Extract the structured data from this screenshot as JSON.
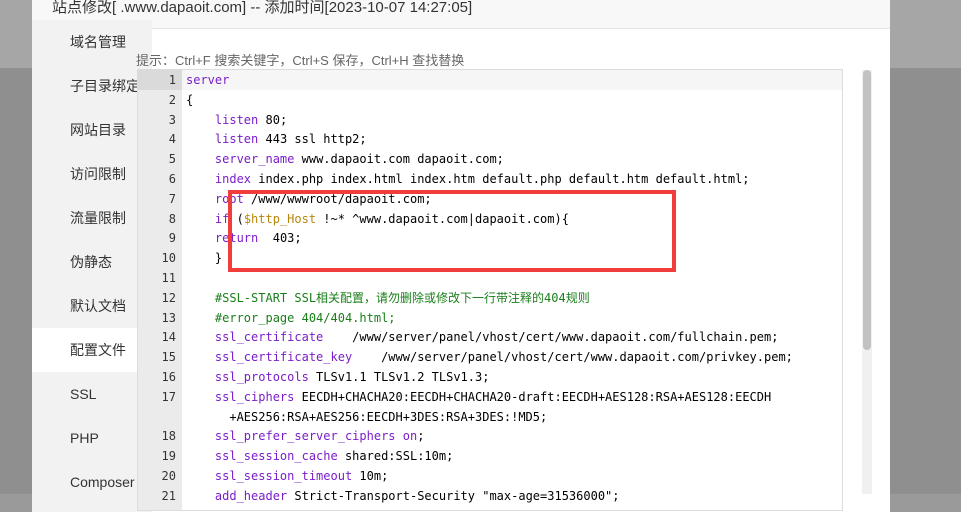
{
  "dialog": {
    "title": "站点修改[ .www.dapaoit.com] -- 添加时间[2023-10-07 14:27:05]"
  },
  "sidebar": {
    "items": [
      {
        "label": "域名管理"
      },
      {
        "label": "子目录绑定"
      },
      {
        "label": "网站目录"
      },
      {
        "label": "访问限制"
      },
      {
        "label": "流量限制"
      },
      {
        "label": "伪静态"
      },
      {
        "label": "默认文档"
      },
      {
        "label": "配置文件",
        "active": true
      },
      {
        "label": "SSL"
      },
      {
        "label": "PHP"
      },
      {
        "label": "Composer"
      }
    ]
  },
  "hint": "提示：Ctrl+F 搜索关键字，Ctrl+S 保存，Ctrl+H 查找替换",
  "editor": {
    "lines": [
      {
        "n": "1",
        "text": "server"
      },
      {
        "n": "2",
        "text": "{"
      },
      {
        "n": "3",
        "text": "    listen 80;"
      },
      {
        "n": "4",
        "text": "    listen 443 ssl http2;"
      },
      {
        "n": "5",
        "text": "    server_name www.dapaoit.com dapaoit.com;"
      },
      {
        "n": "6",
        "text": "    index index.php index.html index.htm default.php default.htm default.html;"
      },
      {
        "n": "7",
        "text": "    root /www/wwwroot/dapaoit.com;"
      },
      {
        "n": "8",
        "text": "    if ($http_Host !~* ^www.dapaoit.com|dapaoit.com){"
      },
      {
        "n": "9",
        "text": "    return  403;"
      },
      {
        "n": "10",
        "text": "    }"
      },
      {
        "n": "11",
        "text": ""
      },
      {
        "n": "12",
        "text": "    #SSL-START SSL相关配置，请勿删除或修改下一行带注释的404规则"
      },
      {
        "n": "13",
        "text": "    #error_page 404/404.html;"
      },
      {
        "n": "14",
        "text": "    ssl_certificate    /www/server/panel/vhost/cert/www.dapaoit.com/fullchain.pem;"
      },
      {
        "n": "15",
        "text": "    ssl_certificate_key    /www/server/panel/vhost/cert/www.dapaoit.com/privkey.pem;"
      },
      {
        "n": "16",
        "text": "    ssl_protocols TLSv1.1 TLSv1.2 TLSv1.3;"
      },
      {
        "n": "17",
        "text": "    ssl_ciphers EECDH+CHACHA20:EECDH+CHACHA20-draft:EECDH+AES128:RSA+AES128:EECDH"
      },
      {
        "n": "",
        "text": "      +AES256:RSA+AES256:EECDH+3DES:RSA+3DES:!MD5;"
      },
      {
        "n": "18",
        "text": "    ssl_prefer_server_ciphers on;"
      },
      {
        "n": "19",
        "text": "    ssl_session_cache shared:SSL:10m;"
      },
      {
        "n": "20",
        "text": "    ssl_session_timeout 10m;"
      },
      {
        "n": "21",
        "text": "    add_header Strict-Transport-Security \"max-age=31536000\";"
      }
    ]
  },
  "colors": {
    "highlight_box": "#f23d3d",
    "keyword": "#7a1ec9",
    "comment": "#1a7f1a",
    "variable": "#b8860b"
  }
}
